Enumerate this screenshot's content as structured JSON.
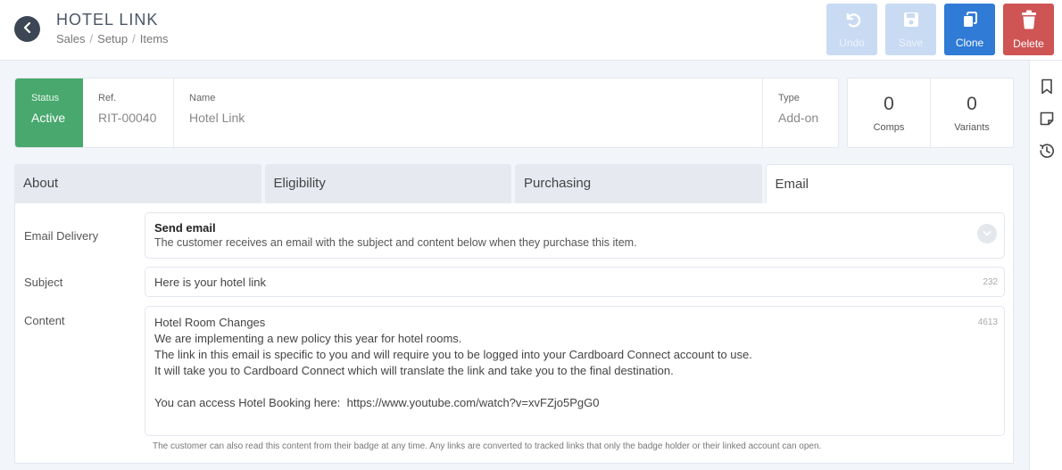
{
  "header": {
    "title": "HOTEL LINK",
    "breadcrumb": [
      "Sales",
      "Setup",
      "Items"
    ],
    "breadcrumb_sep": "/",
    "actions": {
      "undo": "Undo",
      "save": "Save",
      "clone": "Clone",
      "delete": "Delete"
    }
  },
  "info": {
    "status_label": "Status",
    "status_value": "Active",
    "ref_label": "Ref.",
    "ref_value": "RIT-00040",
    "name_label": "Name",
    "name_value": "Hotel Link",
    "type_label": "Type",
    "type_value": "Add-on"
  },
  "counts": {
    "comps_value": "0",
    "comps_label": "Comps",
    "variants_value": "0",
    "variants_label": "Variants"
  },
  "tabs": [
    {
      "label": "About"
    },
    {
      "label": "Eligibility"
    },
    {
      "label": "Purchasing"
    },
    {
      "label": "Email"
    }
  ],
  "email": {
    "delivery_label": "Email Delivery",
    "delivery_title": "Send email",
    "delivery_desc": "The customer receives an email with the subject and content below when they purchase this item.",
    "subject_label": "Subject",
    "subject_value": "Here is your hotel link",
    "subject_remaining": "232",
    "content_label": "Content",
    "content_remaining": "4613",
    "content_lines": [
      "Hotel Room Changes",
      "We are implementing a new policy this year for hotel rooms.",
      "The link in this email is specific to you and will require you to be logged into your Cardboard Connect account to use.",
      "It will take you to Cardboard Connect which will translate the link and take you to the final destination.",
      "",
      "You can access Hotel Booking here:  https://www.youtube.com/watch?v=xvFZjo5PgG0"
    ],
    "help_text": "The customer can also read this content from their badge at any time. Any links are converted to tracked links that only the badge holder or their linked account can open."
  },
  "colors": {
    "status_green": "#48a86e",
    "clone_blue": "#2f7bd5",
    "delete_red": "#cf5454",
    "disabled_blue": "#c9daf3"
  },
  "icons": {
    "back": "chevron-left-icon",
    "undo": "undo-icon",
    "save": "floppy-disk-icon",
    "clone": "copy-icon",
    "delete": "trash-icon",
    "rail": [
      "bookmark-icon",
      "note-icon",
      "history-icon"
    ],
    "delivery_expand": "chevron-down-icon"
  }
}
